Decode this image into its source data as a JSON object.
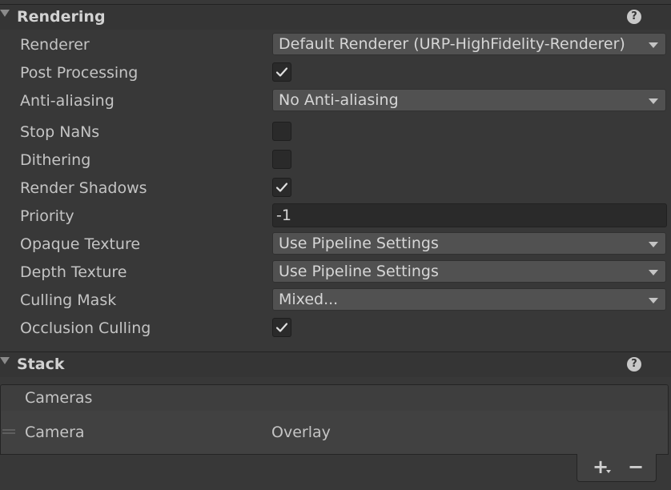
{
  "rendering": {
    "title": "Rendering",
    "help_glyph": "?",
    "fields": {
      "renderer": {
        "label": "Renderer",
        "value": "Default Renderer (URP-HighFidelity-Renderer)"
      },
      "post_processing": {
        "label": "Post Processing",
        "checked": true
      },
      "anti_aliasing": {
        "label": "Anti-aliasing",
        "value": "No Anti-aliasing"
      },
      "stop_nans": {
        "label": "Stop NaNs",
        "checked": false
      },
      "dithering": {
        "label": "Dithering",
        "checked": false
      },
      "render_shadows": {
        "label": "Render Shadows",
        "checked": true
      },
      "priority": {
        "label": "Priority",
        "value": "-1"
      },
      "opaque_texture": {
        "label": "Opaque Texture",
        "value": "Use Pipeline Settings"
      },
      "depth_texture": {
        "label": "Depth Texture",
        "value": "Use Pipeline Settings"
      },
      "culling_mask": {
        "label": "Culling Mask",
        "value": "Mixed..."
      },
      "occlusion_culling": {
        "label": "Occlusion Culling",
        "checked": true
      }
    }
  },
  "stack": {
    "title": "Stack",
    "help_glyph": "?",
    "list_header": "Cameras",
    "items": [
      {
        "name": "Camera",
        "type": "Overlay"
      }
    ],
    "add_label": "+",
    "remove_label": "−"
  },
  "icons": {
    "foldout": "triangle-down-icon",
    "help": "help-circle-icon",
    "check": "checkmark-icon",
    "dropdown": "caret-down-icon",
    "drag": "drag-handle-icon"
  },
  "colors": {
    "background": "#383838",
    "header": "#353535",
    "dropdown": "#515151",
    "input": "#2a2a2a",
    "text": "#c4c4c4"
  }
}
